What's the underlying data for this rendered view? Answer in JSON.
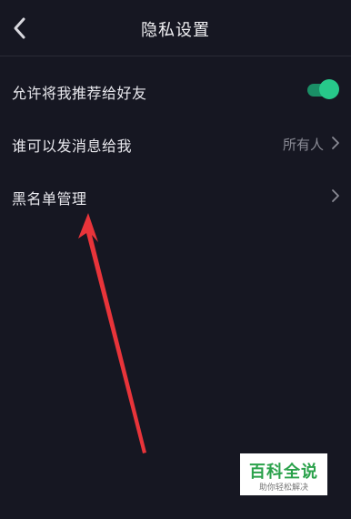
{
  "header": {
    "title": "隐私设置",
    "back_icon": "chevron-left-icon"
  },
  "settings": {
    "recommend_to_friends": {
      "label": "允许将我推荐给好友",
      "enabled": true
    },
    "who_can_message": {
      "label": "谁可以发消息给我",
      "value": "所有人"
    },
    "blacklist": {
      "label": "黑名单管理"
    }
  },
  "watermark": {
    "title": "百科全说",
    "subtitle": "助你轻松解决"
  },
  "colors": {
    "background": "#161722",
    "toggle_on": "#27c88a",
    "annotation_arrow": "#e8343a",
    "watermark_green": "#2ba24c"
  }
}
